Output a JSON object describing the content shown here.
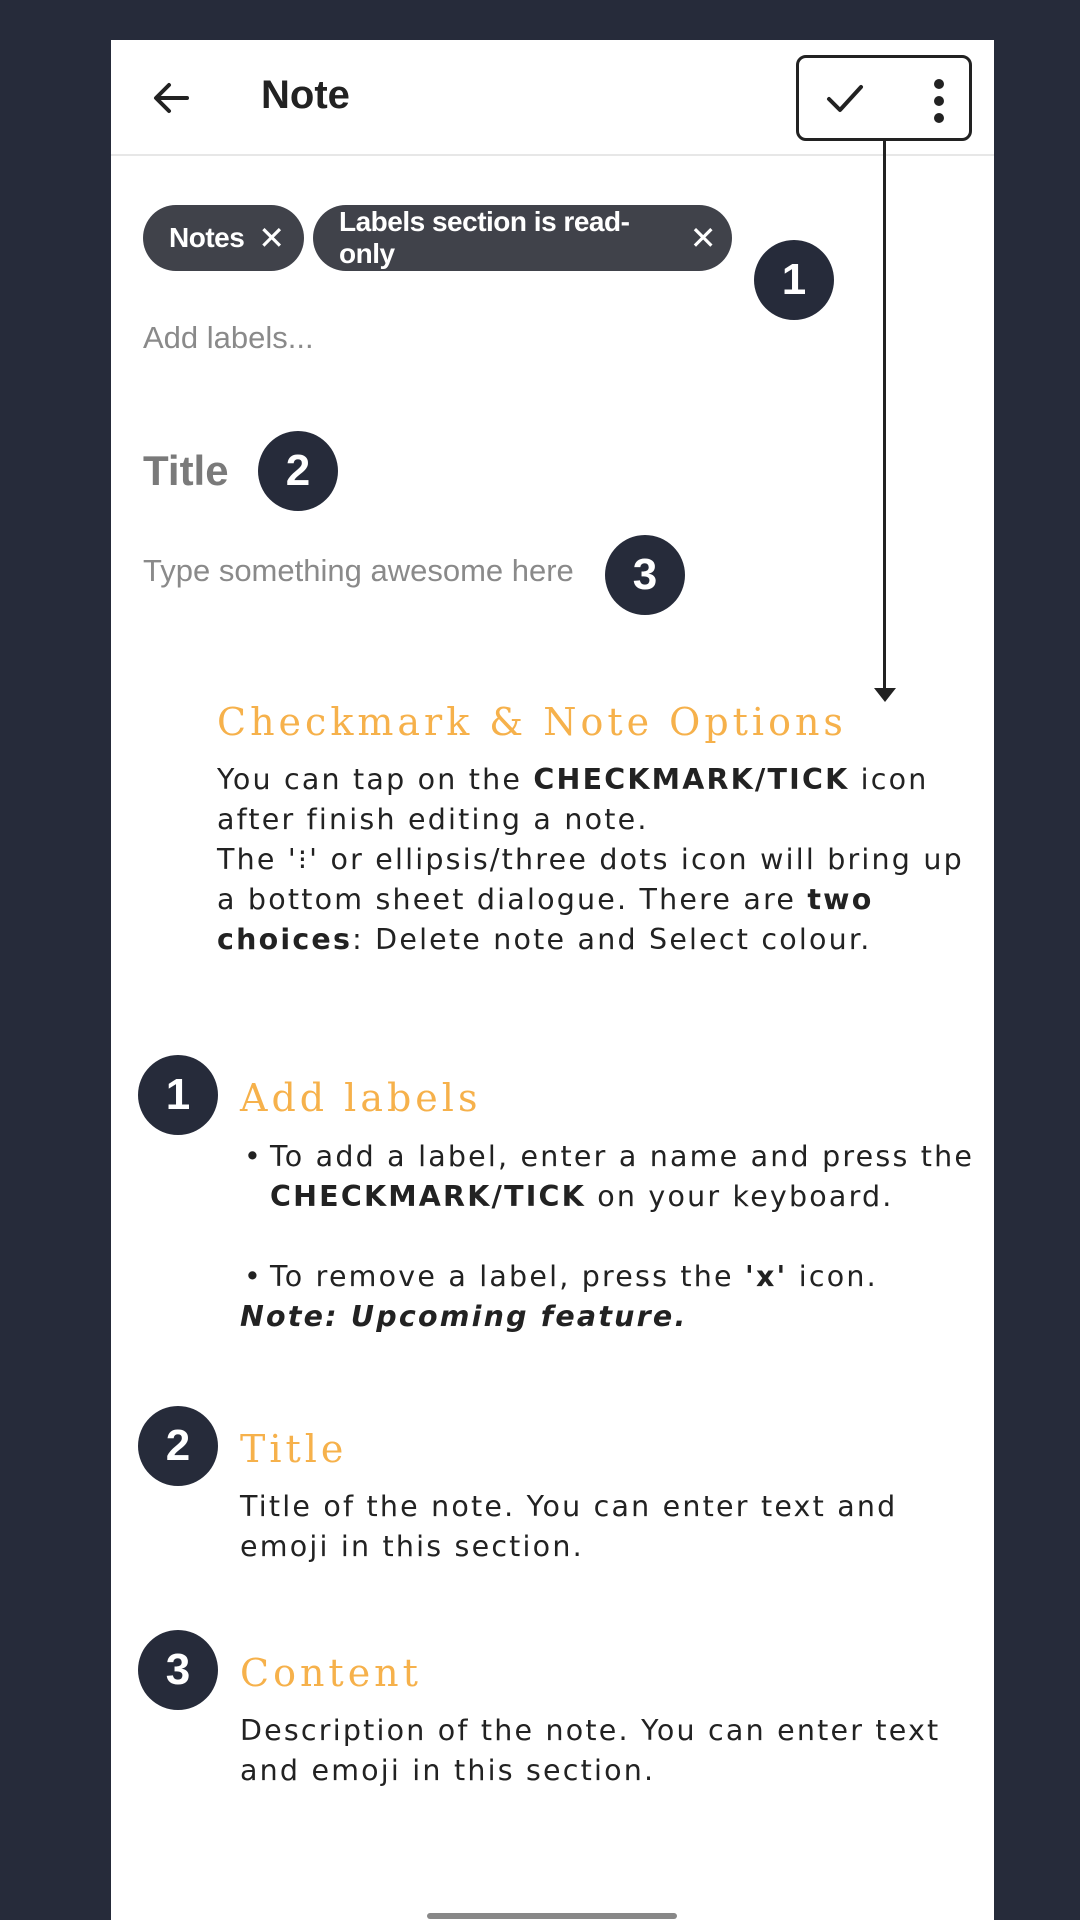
{
  "appbar": {
    "title": "Note",
    "back_icon": "arrow-left-icon",
    "check_icon": "check-icon",
    "more_icon": "more-vertical-icon"
  },
  "labels": {
    "chips": [
      "Notes",
      "Labels section is read-only"
    ],
    "remove_glyph": "✕",
    "placeholder": "Add labels..."
  },
  "note": {
    "title_placeholder": "Title",
    "content_placeholder": "Type something awesome here"
  },
  "badges": [
    "1",
    "2",
    "3"
  ],
  "guide": {
    "options": {
      "heading": "Checkmark & Note Options",
      "line1_pre": "You can tap on the ",
      "line1_bold": "CHECKMARK/TICK",
      "line1_post": " icon after finish editing a note.",
      "line2_pre": "The '⁝' or ellipsis/three dots icon will bring up a bottom sheet dialogue. There are ",
      "line2_bold": "two choices",
      "line2_post": ": Delete note and Select colour."
    },
    "labels": {
      "heading": "Add labels",
      "bullet1_pre": "To add a label, enter a name and press the ",
      "bullet1_bold": "CHECKMARK/TICK",
      "bullet1_post": " on your keyboard.",
      "bullet2_pre": "To remove a label, press the ",
      "bullet2_bold": "'x'",
      "bullet2_post": " icon.",
      "note": "Note: Upcoming feature."
    },
    "title": {
      "heading": "Title",
      "text": "Title of the note. You can enter text and emoji in this section."
    },
    "content": {
      "heading": "Content",
      "text": "Description of the note. You can enter text and emoji in this section."
    }
  },
  "colors": {
    "background": "#262b3a",
    "accent": "#f6b14b",
    "chip": "#40424a"
  }
}
